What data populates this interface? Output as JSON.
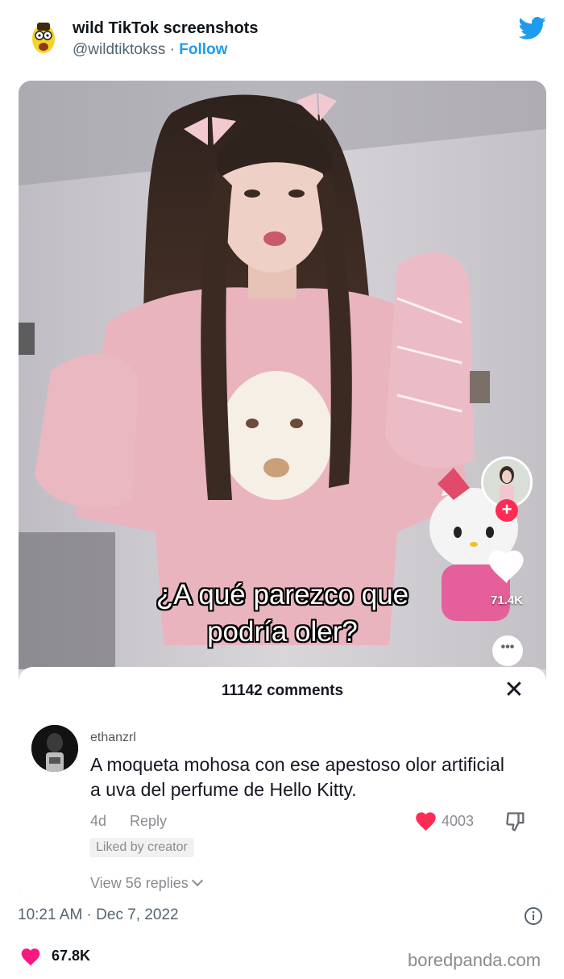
{
  "tweet": {
    "account_name": "wild TikTok screenshots",
    "handle": "@wildtiktokss",
    "separator": " · ",
    "follow_label": "Follow",
    "timestamp": "10:21 AM · Dec 7, 2022",
    "likes": "67.8K"
  },
  "tiktok": {
    "caption_line1": "¿A qué parezco que",
    "caption_line2": "podría oler?",
    "side_like_count": "71.4K",
    "comments_count": "11142 comments",
    "close_symbol": "✕",
    "comment": {
      "username": "ethanzrl",
      "text": "A moqueta mohosa con ese apestoso olor artificial a uva del perfume de Hello Kitty.",
      "age": "4d",
      "reply_label": "Reply",
      "like_count": "4003",
      "liked_badge": "Liked by creator",
      "view_replies": "View 56 replies"
    }
  },
  "watermark": "boredpanda.com",
  "colors": {
    "twitter_blue": "#1d9bf0",
    "tiktok_red": "#fe2c55",
    "like_pink": "#f91880"
  }
}
